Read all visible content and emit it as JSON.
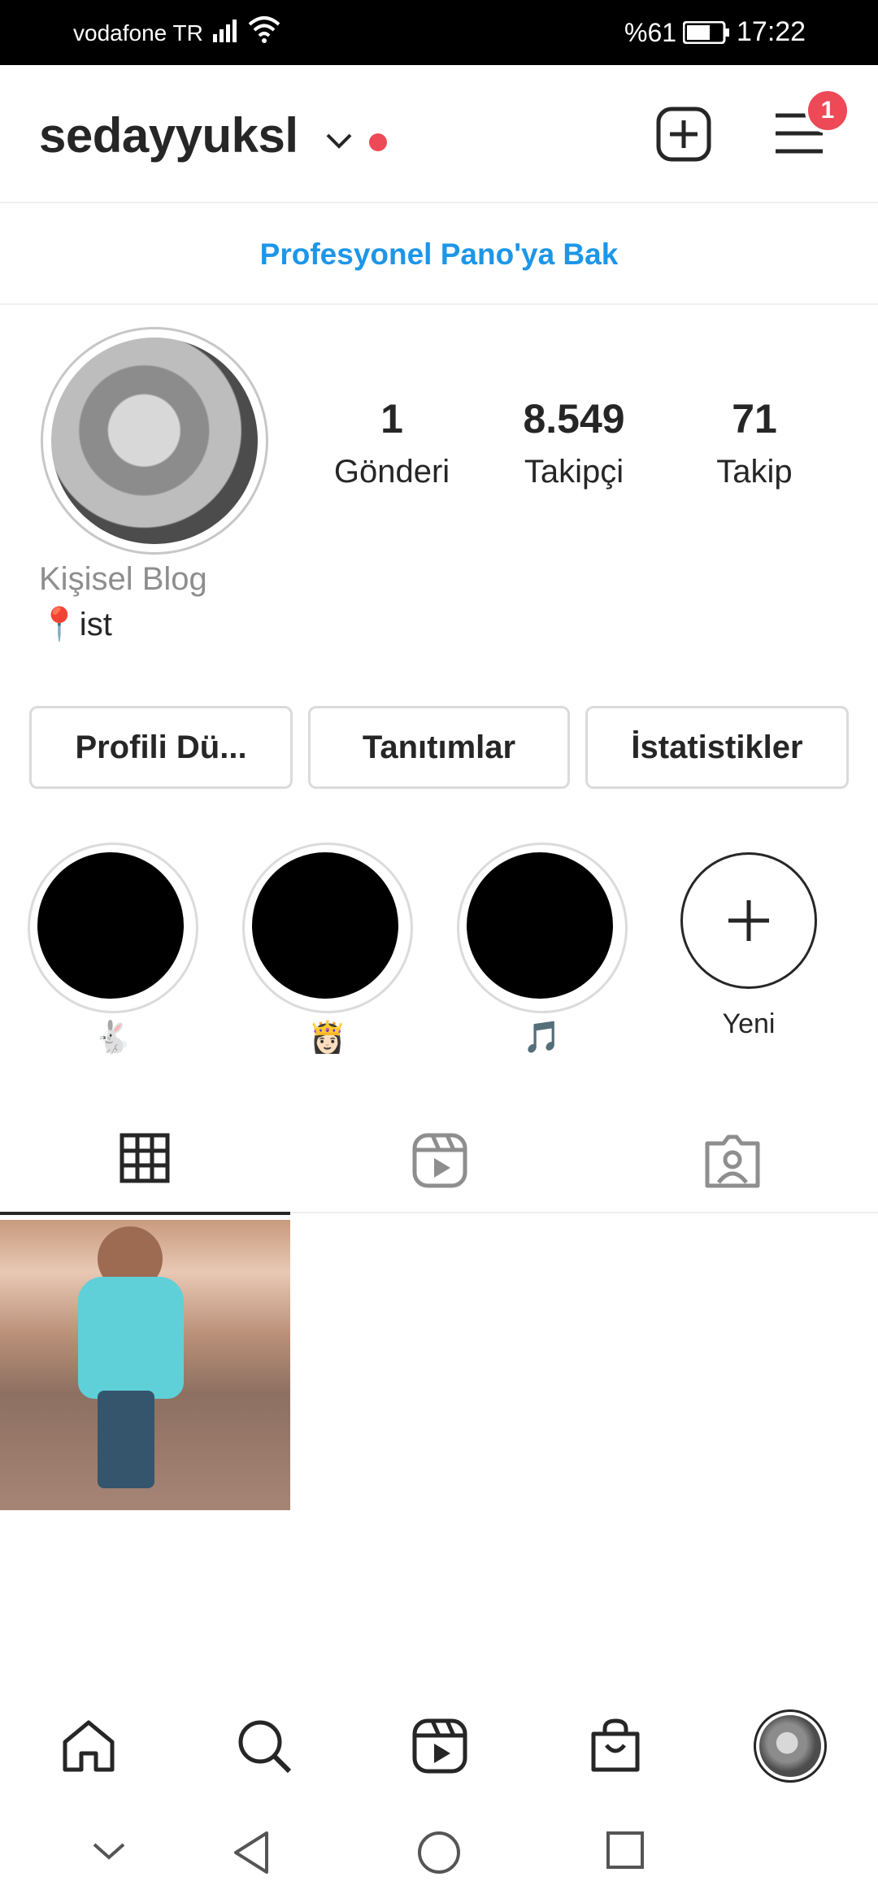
{
  "status_bar": {
    "carrier": "vodafone TR",
    "battery_percent": "%61",
    "time": "17:22",
    "icons": [
      "signal-icon",
      "wifi-icon",
      "battery-icon"
    ]
  },
  "header": {
    "username": "sedayyuksl",
    "notification_count": "1",
    "icons": [
      "chevron-down-icon",
      "add-post-icon",
      "menu-icon"
    ]
  },
  "professional_dashboard": {
    "label": "Profesyonel Pano'ya Bak"
  },
  "profile": {
    "stats": [
      {
        "value": "1",
        "label": "Gönderi"
      },
      {
        "value": "8.549",
        "label": "Takipçi"
      },
      {
        "value": "71",
        "label": "Takip"
      }
    ],
    "category": "Kişisel Blog",
    "location": "📍ist"
  },
  "actions": {
    "edit_profile": "Profili Dü...",
    "promotions": "Tanıtımlar",
    "insights": "İstatistikler"
  },
  "highlights": [
    {
      "label": "🐇"
    },
    {
      "label": "👸🏻"
    },
    {
      "label": "🎵"
    }
  ],
  "new_highlight": {
    "label": "Yeni"
  },
  "tabs": [
    {
      "name": "grid",
      "icon": "grid-icon",
      "active": true
    },
    {
      "name": "reels",
      "icon": "reels-icon",
      "active": false
    },
    {
      "name": "tagged",
      "icon": "tagged-icon",
      "active": false
    }
  ],
  "posts_count": 1,
  "bottom_nav": {
    "items": [
      "home-icon",
      "search-icon",
      "reels-icon",
      "shop-icon",
      "profile-avatar"
    ]
  },
  "system_nav": {
    "items": [
      "hide-chevron-icon",
      "back-icon",
      "home-circle-icon",
      "recents-icon"
    ]
  },
  "colors": {
    "accent_blue": "#1c96e8",
    "badge_red": "#ed4956",
    "text": "#262626",
    "muted": "#8e8e8e",
    "border": "#dbdbdb"
  }
}
